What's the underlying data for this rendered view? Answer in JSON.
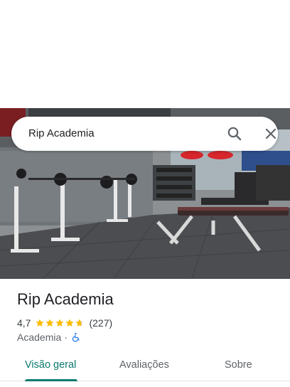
{
  "search": {
    "query": "Rip Academia"
  },
  "place": {
    "name": "Rip Academia",
    "rating": "4,7",
    "stars": 4.7,
    "review_count": "(227)",
    "category": "Academia",
    "separator": "·",
    "accessibility_icon": "wheelchair-icon"
  },
  "tabs": [
    {
      "label": "Visão geral",
      "active": true
    },
    {
      "label": "Avaliações",
      "active": false
    },
    {
      "label": "Sobre",
      "active": false
    }
  ],
  "colors": {
    "accent": "#0b7a6e",
    "star": "#fbbc04",
    "accessibility": "#1a73e8"
  },
  "icons": {
    "search": "search-icon",
    "close": "close-icon"
  }
}
